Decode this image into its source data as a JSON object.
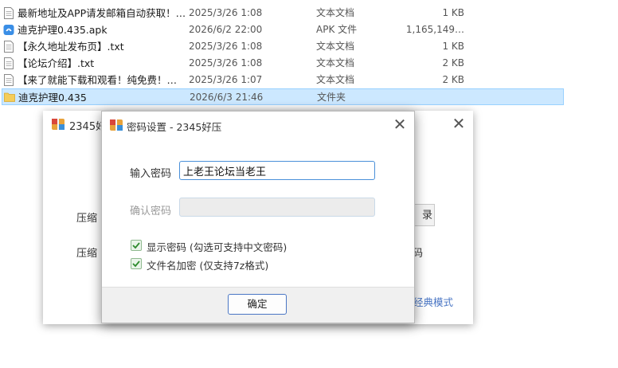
{
  "files": [
    {
      "name": "最新地址及APP请发邮箱自动获取！…",
      "date": "2025/3/26 1:08",
      "type": "文本文档",
      "size": "1 KB",
      "icon": "text-file-icon"
    },
    {
      "name": "迪克护理0.435.apk",
      "date": "2026/6/2 22:00",
      "type": "APK 文件",
      "size": "1,165,149…",
      "icon": "apk-file-icon"
    },
    {
      "name": "【永久地址发布页】.txt",
      "date": "2025/3/26 1:08",
      "type": "文本文档",
      "size": "1 KB",
      "icon": "text-file-icon"
    },
    {
      "name": "【论坛介绍】.txt",
      "date": "2025/3/26 1:08",
      "type": "文本文档",
      "size": "2 KB",
      "icon": "text-file-icon"
    },
    {
      "name": "【来了就能下载和观看！纯免费！…",
      "date": "2025/3/26 1:07",
      "type": "文本文档",
      "size": "2 KB",
      "icon": "text-file-icon"
    },
    {
      "name": "迪克护理0.435",
      "date": "2026/6/3 21:46",
      "type": "文件夹",
      "size": "",
      "icon": "folder-icon",
      "selected": true
    }
  ],
  "back_dialog": {
    "title": "2345好",
    "close": "✕",
    "text1": "压缩",
    "text2": "压缩",
    "button_partial": "录",
    "text3": "码",
    "link": "经典模式"
  },
  "password_dialog": {
    "title": "密码设置 - 2345好压",
    "close": "✕",
    "password_label": "输入密码",
    "password_value": "上老王论坛当老王",
    "confirm_label": "确认密码",
    "confirm_value": "",
    "show_password_label": "显示密码 (勾选可支持中文密码)",
    "show_password_checked": true,
    "encrypt_names_label": "文件名加密 (仅支持7z格式)",
    "encrypt_names_checked": true,
    "ok_label": "确定"
  },
  "colors": {
    "selection_bg": "#cce8ff",
    "accent": "#4a90d9",
    "link": "#4a76c4"
  }
}
